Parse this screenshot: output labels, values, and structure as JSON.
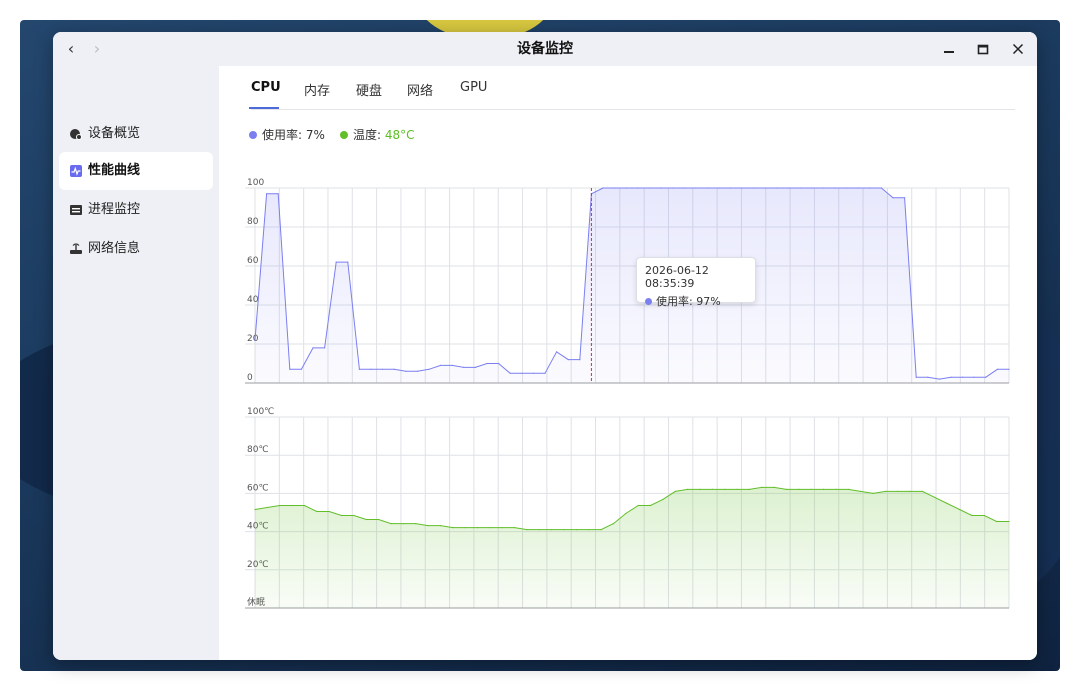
{
  "window": {
    "title": "设备监控",
    "nav": {
      "back_glyph": "‹",
      "forward_glyph": "›"
    }
  },
  "sidebar": {
    "items": [
      {
        "label": "设备概览",
        "icon": "overview-icon"
      },
      {
        "label": "性能曲线",
        "icon": "performance-chart-icon",
        "active": true
      },
      {
        "label": "进程监控",
        "icon": "process-list-icon"
      },
      {
        "label": "网络信息",
        "icon": "network-router-icon"
      }
    ]
  },
  "tabs": [
    {
      "label": "CPU",
      "active": true
    },
    {
      "label": "内存"
    },
    {
      "label": "硬盘"
    },
    {
      "label": "网络"
    },
    {
      "label": "GPU"
    }
  ],
  "legend": {
    "usage_label": "使用率: ",
    "usage_value": "7%",
    "temp_label": "温度: ",
    "temp_value": "48°C"
  },
  "colors": {
    "usage": "#7b7ff0",
    "temperature": "#62bf2a",
    "tab_accent": "#4c6bd8",
    "cursor_line": "#e0263c"
  },
  "tooltip": {
    "timestamp": "2026-06-12 08:35:39",
    "series_label": "使用率: ",
    "value": "97%"
  },
  "chart_data": [
    {
      "type": "area",
      "series": [
        {
          "name": "使用率",
          "values": [
            22,
            97,
            97,
            7,
            7,
            18,
            18,
            62,
            62,
            7,
            7,
            7,
            7,
            6,
            6,
            7,
            9,
            9,
            8,
            8,
            10,
            10,
            5,
            5,
            5,
            5,
            16,
            12,
            12,
            97,
            100,
            100,
            100,
            100,
            100,
            100,
            100,
            100,
            100,
            100,
            100,
            100,
            100,
            100,
            100,
            100,
            100,
            100,
            100,
            100,
            100,
            100,
            100,
            100,
            100,
            95,
            95,
            3,
            3,
            2,
            3,
            3,
            3,
            3,
            7,
            7
          ]
        }
      ],
      "ylim": [
        0,
        100
      ],
      "y_ticks": [
        "0",
        "20",
        "40",
        "60",
        "80",
        "100"
      ],
      "grid": true,
      "cursor_index": 29
    },
    {
      "type": "area",
      "series": [
        {
          "name": "温度",
          "values": [
            54,
            55,
            56,
            56,
            56,
            53,
            53,
            51,
            51,
            49,
            49,
            47,
            47,
            47,
            46,
            46,
            45,
            45,
            45,
            45,
            45,
            45,
            44,
            44,
            44,
            44,
            44,
            44,
            44,
            47,
            52,
            56,
            56,
            59,
            63,
            64,
            64,
            64,
            64,
            64,
            64,
            65,
            65,
            64,
            64,
            64,
            64,
            64,
            64,
            63,
            62,
            63,
            63,
            63,
            63,
            60,
            57,
            54,
            51,
            51,
            48,
            48
          ]
        }
      ],
      "ylim": [
        5,
        100
      ],
      "y_ticks": [
        "休眠",
        "20℃",
        "40℃",
        "60℃",
        "80℃",
        "100℃"
      ],
      "grid": true
    }
  ]
}
